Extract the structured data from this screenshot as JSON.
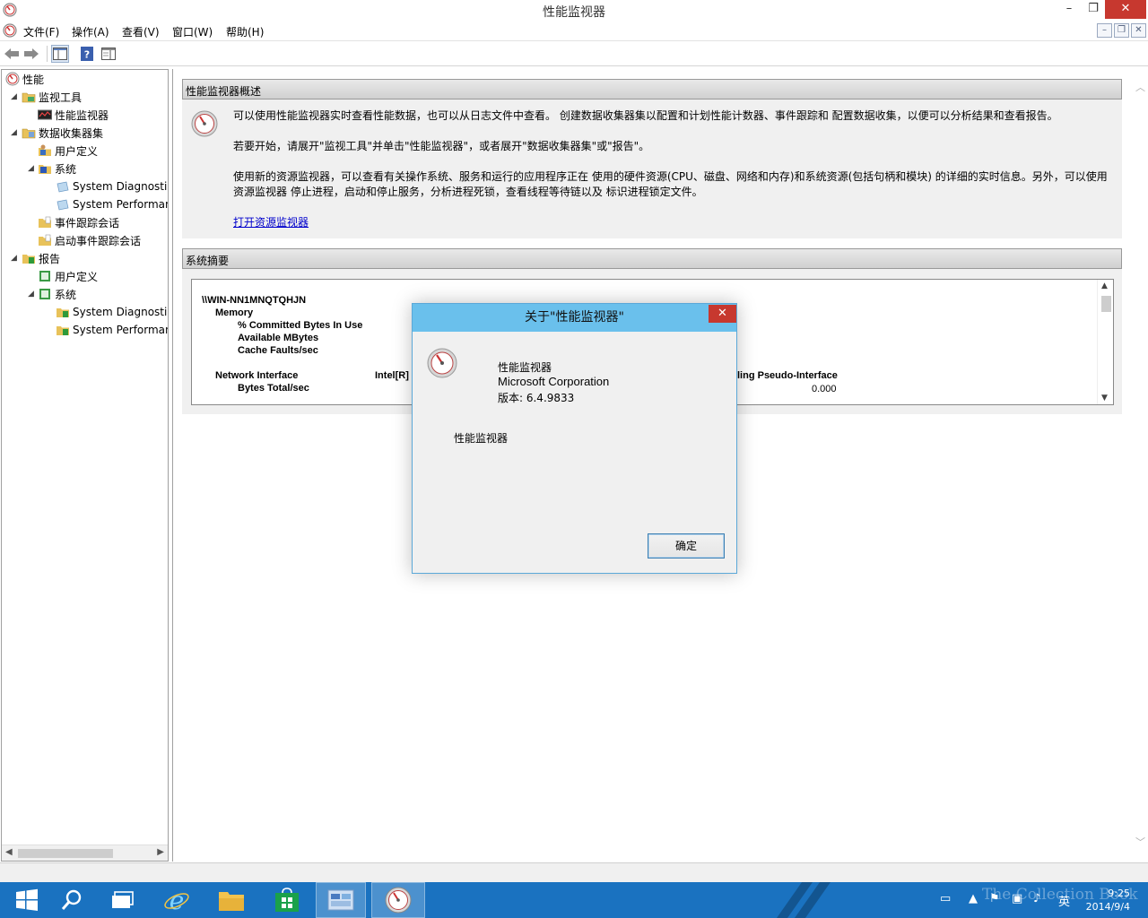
{
  "window": {
    "title": "性能监视器",
    "min_glyph": "–",
    "max_glyph": "❐",
    "close_glyph": "✕"
  },
  "menu": {
    "items": [
      "文件(F)",
      "操作(A)",
      "查看(V)",
      "窗口(W)",
      "帮助(H)"
    ],
    "mdi": [
      "–",
      "❐",
      "✕"
    ]
  },
  "toolbar": {
    "back_glyph": "◀",
    "forward_glyph": "▶",
    "help_glyph": "?"
  },
  "tree": {
    "root": "性能",
    "monitoring_tools": "监视工具",
    "perfmon": "性能监视器",
    "collector_sets": "数据收集器集",
    "user_defined": "用户定义",
    "system": "系统",
    "sys_diag": "System Diagnostics",
    "sys_perf": "System Performance",
    "event_trace": "事件跟踪会话",
    "startup_trace": "启动事件跟踪会话",
    "reports": "报告",
    "rep_user_defined": "用户定义",
    "rep_system": "系统",
    "rep_sys_diag": "System Diagnostics",
    "rep_sys_perf": "System Performance"
  },
  "overview": {
    "header": "性能监视器概述",
    "p1": "可以使用性能监视器实时查看性能数据，也可以从日志文件中查看。 创建数据收集器集以配置和计划性能计数器、事件跟踪和 配置数据收集，以便可以分析结果和查看报告。",
    "p2": "若要开始，请展开\"监视工具\"并单击\"性能监视器\"，或者展开\"数据收集器集\"或\"报告\"。",
    "p3": "使用新的资源监视器，可以查看有关操作系统、服务和运行的应用程序正在 使用的硬件资源(CPU、磁盘、网络和内存)和系统资源(包括句柄和模块) 的详细的实时信息。另外，可以使用资源监视器 停止进程，启动和停止服务，分析进程死锁，查看线程等待链以及 标识进程锁定文件。",
    "link": "打开资源监视器"
  },
  "summary": {
    "header": "系统摘要",
    "machine": "\\\\WIN-NN1MNQTQHJN",
    "memory": "Memory",
    "counter1": "% Committed Bytes In Use",
    "counter2": "Available MBytes",
    "counter3": "Cache Faults/sec",
    "network": "Network Interface",
    "net_instance": "Intel[R]",
    "net_instance2": "ling Pseudo-Interface",
    "counter4": "Bytes Total/sec",
    "net_value": "0.000"
  },
  "dialog": {
    "title": "关于\"性能监视器\"",
    "close_glyph": "✕",
    "product": "性能监视器",
    "company": "Microsoft Corporation",
    "version": "版本: 6.4.9833",
    "description": "性能监视器",
    "ok": "确定"
  },
  "taskbar": {
    "ime": "英",
    "time": "9:25",
    "date": "2014/9/4",
    "watermark": "The Collection Book"
  },
  "colors": {
    "taskbar": "#1a72c0",
    "dialog_title": "#6ac0ec",
    "close": "#c7382f",
    "link": "#0000cc"
  }
}
